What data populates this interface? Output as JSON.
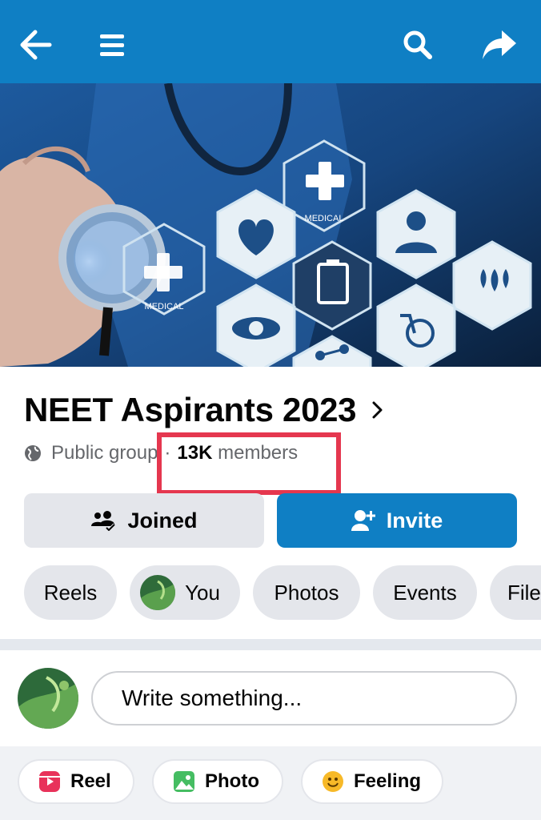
{
  "topbar": {
    "back_icon": "arrow-left-icon",
    "menu_icon": "hamburger-icon",
    "search_icon": "search-icon",
    "share_icon": "share-icon",
    "color": "#0f7fc4"
  },
  "cover": {
    "labels": [
      "MEDICAL",
      "MEDICAL"
    ]
  },
  "group": {
    "name": "NEET Aspirants 2023",
    "privacy": "Public group",
    "separator": "·",
    "member_count": "13K",
    "member_word": "members"
  },
  "actions": {
    "joined_label": "Joined",
    "invite_label": "Invite"
  },
  "chips": [
    "Reels",
    "You",
    "Photos",
    "Events",
    "File"
  ],
  "composer": {
    "placeholder": "Write something..."
  },
  "post_options": [
    "Reel",
    "Photo",
    "Feeling"
  ],
  "colors": {
    "accent": "#0f7fc4",
    "highlight": "#e5374f",
    "chip_bg": "#e4e6eb"
  }
}
